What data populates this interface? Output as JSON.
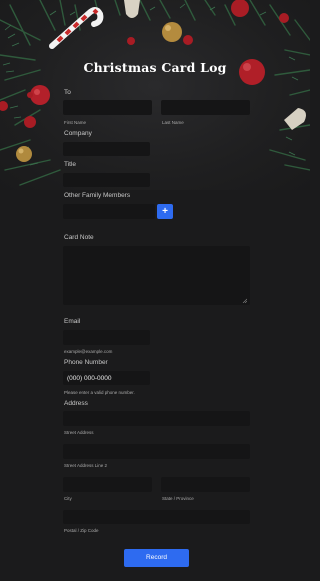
{
  "title": "Christmas Card Log",
  "form": {
    "to_label": "To",
    "first_name_label": "First Name",
    "last_name_label": "Last Name",
    "company_label": "Company",
    "title_label": "Title",
    "other_family_label": "Other Family Members",
    "add_button_label": "+",
    "card_note_label": "Card Note",
    "email_label": "Email",
    "email_hint": "example@example.com",
    "phone_label": "Phone Number",
    "phone_value": "(000) 000-0000",
    "phone_hint": "Please enter a valid phone number.",
    "address_label": "Address",
    "street_label": "Street Address",
    "street2_label": "Street Address Line 2",
    "city_label": "City",
    "state_label": "State / Province",
    "postal_label": "Postal / Zip Code",
    "submit_label": "Record"
  },
  "colors": {
    "accent": "#2e6bf0",
    "background": "#1b1b1c",
    "field": "#151516"
  },
  "icons": {
    "decoration": "christmas-branches-ornaments",
    "add": "plus-icon",
    "resize": "resize-handle-icon"
  }
}
